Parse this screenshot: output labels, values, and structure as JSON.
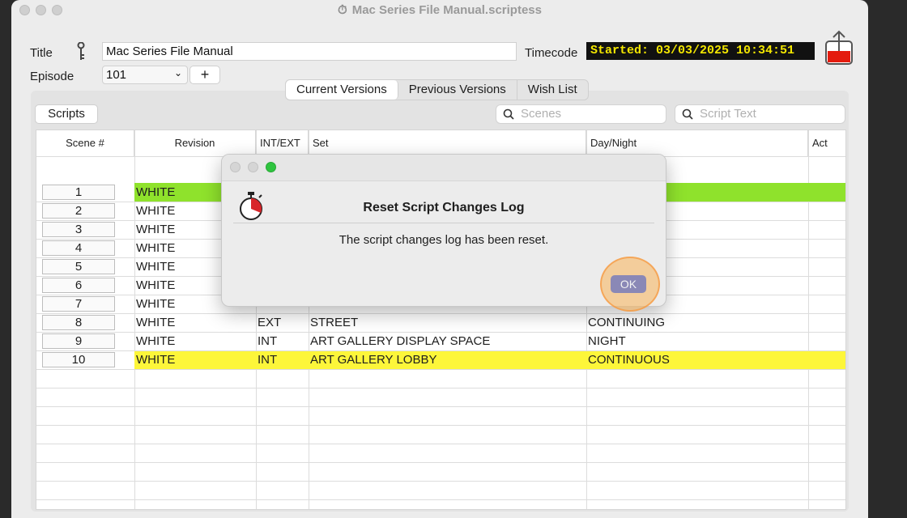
{
  "window": {
    "title": "Mac Series File Manual.scriptess"
  },
  "header": {
    "title_label": "Title",
    "title_value": "Mac Series File Manual",
    "episode_label": "Episode",
    "episode_value": "101",
    "add_label": "+",
    "timecode_label": "Timecode",
    "timecode_value": "Started: 03/03/2025 10:34:51"
  },
  "tabs": [
    "Current Versions",
    "Previous Versions",
    "Wish List"
  ],
  "scripts_button": "Scripts",
  "search": {
    "scenes_placeholder": "Scenes",
    "script_text_placeholder": "Script Text"
  },
  "table": {
    "columns": [
      "Scene #",
      "Revision",
      "INT/EXT",
      "Set",
      "Day/Night",
      "Act"
    ],
    "rows": [
      {
        "scene": "1",
        "revision": "WHITE",
        "intext": "",
        "set": "",
        "daynight": ""
      },
      {
        "scene": "2",
        "revision": "WHITE",
        "intext": "",
        "set": "",
        "daynight": ""
      },
      {
        "scene": "3",
        "revision": "WHITE",
        "intext": "",
        "set": "",
        "daynight": ""
      },
      {
        "scene": "4",
        "revision": "WHITE",
        "intext": "",
        "set": "",
        "daynight": ""
      },
      {
        "scene": "5",
        "revision": "WHITE",
        "intext": "",
        "set": "",
        "daynight": ""
      },
      {
        "scene": "6",
        "revision": "WHITE",
        "intext": "",
        "set": "",
        "daynight": ""
      },
      {
        "scene": "7",
        "revision": "WHITE",
        "intext": "",
        "set": "",
        "daynight": ""
      },
      {
        "scene": "8",
        "revision": "WHITE",
        "intext": "EXT",
        "set": "STREET",
        "daynight": "CONTINUING"
      },
      {
        "scene": "9",
        "revision": "WHITE",
        "intext": "INT",
        "set": "ART GALLERY DISPLAY SPACE",
        "daynight": "NIGHT"
      },
      {
        "scene": "10",
        "revision": "WHITE",
        "intext": "INT",
        "set": "ART GALLERY LOBBY",
        "daynight": "CONTINUOUS"
      }
    ],
    "highlight_colors": {
      "row1": "#8fe22c",
      "row10": "#fdf63a"
    }
  },
  "dialog": {
    "title": "Reset Script Changes Log",
    "message": "The script changes log has been reset.",
    "ok_label": "OK",
    "icon": "stopwatch-icon"
  }
}
